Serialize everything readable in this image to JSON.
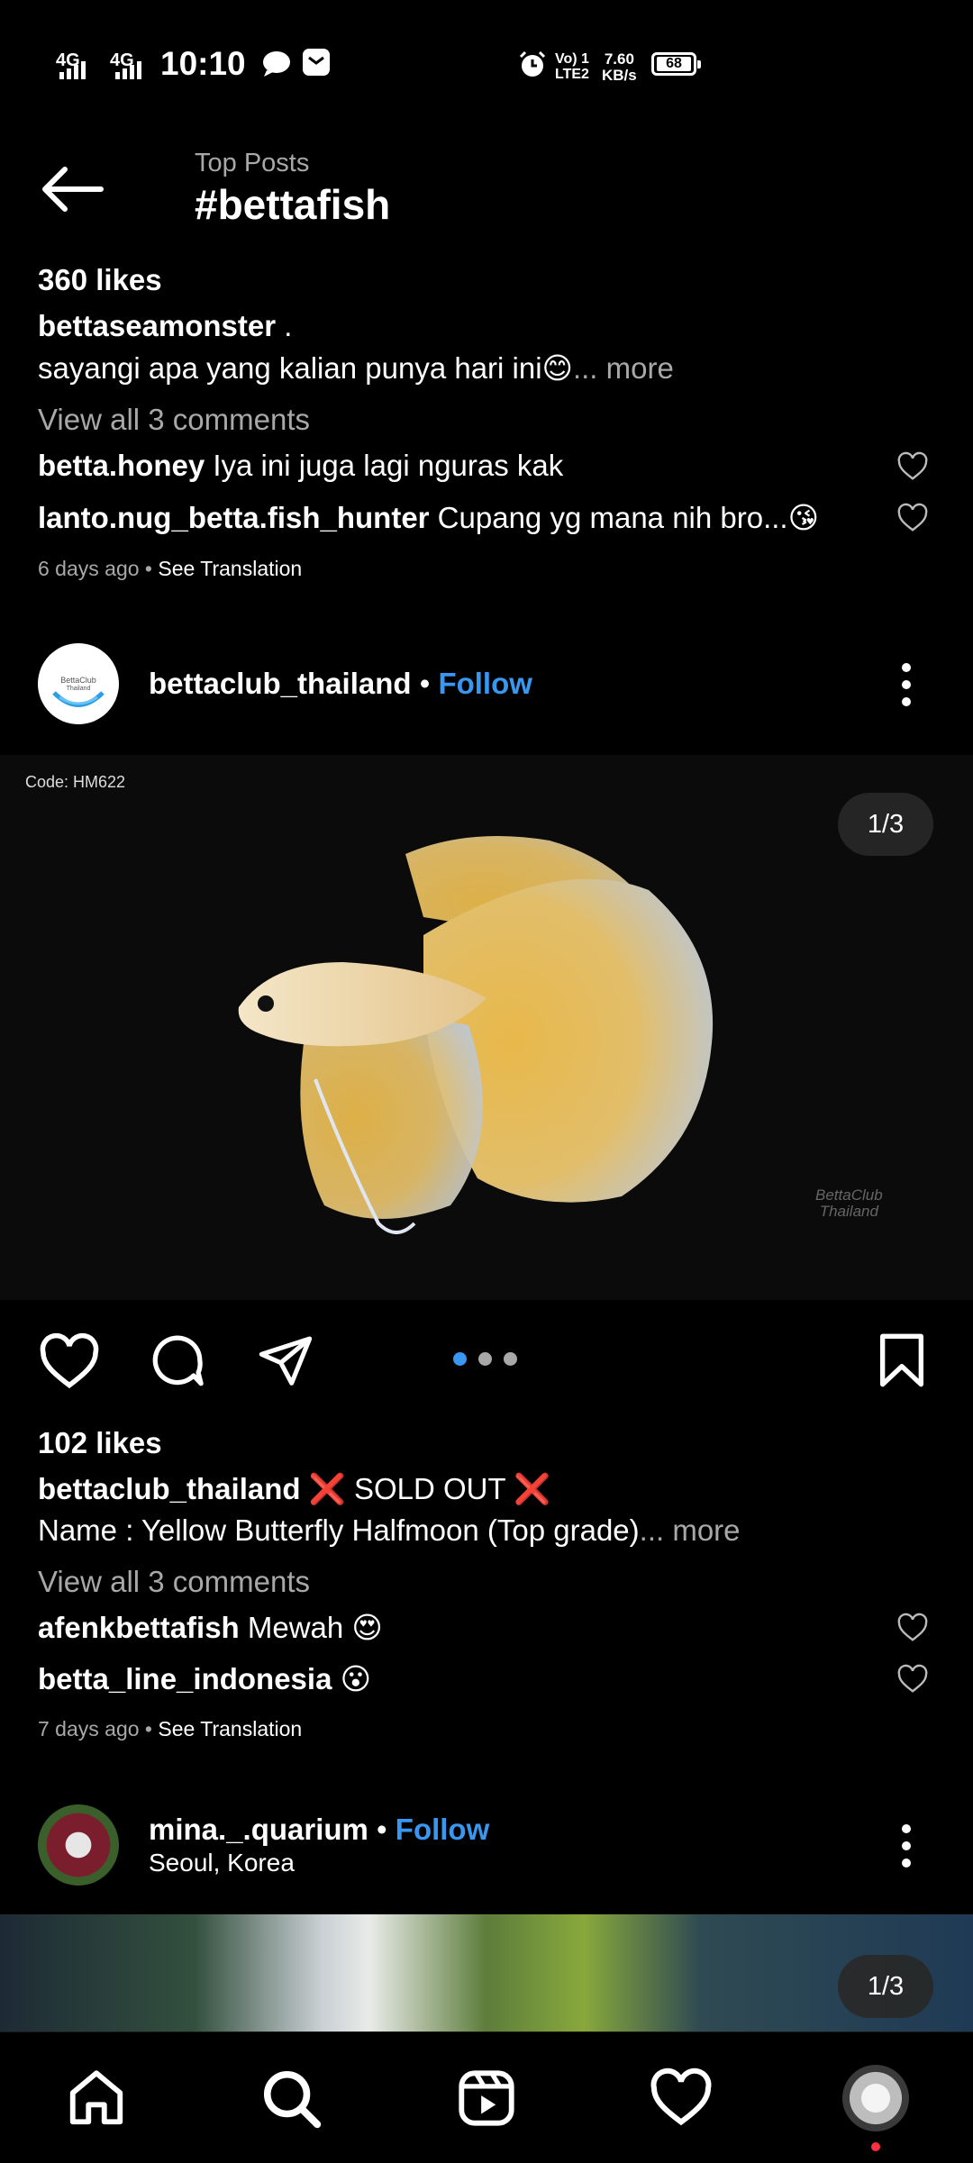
{
  "status_bar": {
    "net1": "4G",
    "net2": "4G",
    "time": "10:10",
    "volte": "Vo) 1\nLTE2",
    "speed_value": "7.60",
    "speed_unit": "KB/s",
    "battery": "68"
  },
  "header": {
    "subtitle": "Top Posts",
    "title": "#bettafish"
  },
  "post1": {
    "likes": "360 likes",
    "username": "bettaseamonster",
    "username_suffix": " .",
    "caption": "sayangi apa yang kalian punya hari ini😊",
    "caption_more": "... more",
    "view_comments": "View all 3 comments",
    "comments": [
      {
        "user": "betta.honey",
        "text": " Iya ini juga lagi nguras kak"
      },
      {
        "user": "lanto.nug_betta.fish_hunter",
        "text": " Cupang yg mana nih bro...😘"
      }
    ],
    "time": "6 days ago",
    "see_translation": "See Translation"
  },
  "post2": {
    "username": "bettaclub_thailand",
    "separator": " • ",
    "follow": "Follow",
    "image_code": "Code: HM622",
    "counter": "1/3",
    "watermark": "BettaClub\nThailand",
    "likes": "102 likes",
    "caption_user": "bettaclub_thailand",
    "caption_title": " ❌ SOLD OUT ❌",
    "caption": "Name : Yellow Butterfly Halfmoon (Top grade)",
    "caption_more": "... more",
    "view_comments": "View all 3 comments",
    "comments": [
      {
        "user": "afenkbettafish",
        "text": " Mewah 😍"
      },
      {
        "user": "betta_line_indonesia",
        "text": " 😮"
      }
    ],
    "time": "7 days ago",
    "see_translation": "See Translation"
  },
  "post3": {
    "username": "mina._.quarium",
    "separator": " • ",
    "follow": "Follow",
    "location": "Seoul, Korea",
    "counter": "1/3"
  },
  "colors": {
    "background": "#000000",
    "accent": "#3897f0",
    "secondary_text": "#a8a8a8",
    "notification_dot": "#ff3040"
  },
  "nav": {
    "items": [
      "home-icon",
      "search-icon",
      "reels-icon",
      "activity-heart-icon",
      "profile-avatar"
    ]
  }
}
